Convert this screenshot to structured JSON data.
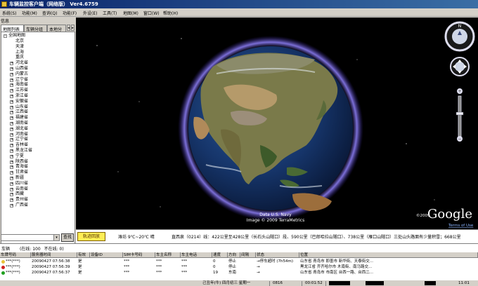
{
  "window": {
    "title": "车辆监控客户端（网络版） Ver4.6759"
  },
  "menu": [
    "系统(S)",
    "功能(M)",
    "查询(Q)",
    "功能(F)",
    "外设(E)",
    "工具(T)",
    "地图(M)",
    "窗口(W)",
    "帮助(H)"
  ],
  "left_panel": {
    "title": "信息",
    "tabs": [
      "地图列表",
      "车辆分组",
      "本地分"
    ],
    "tree_root": "全国地图",
    "cities": [
      "北京",
      "天津",
      "上海",
      "重庆"
    ],
    "provinces": [
      "河北省",
      "山西省",
      "内蒙古",
      "辽宁省",
      "海南省",
      "江苏省",
      "浙江省",
      "安徽省",
      "山东省",
      "江西省",
      "福建省",
      "湖南省",
      "湖北省",
      "河南省",
      "辽宁省",
      "吉林省",
      "黑龙江省",
      "宁夏",
      "陕西省",
      "青海省",
      "甘肃省",
      "新疆",
      "四川省",
      "云南省",
      "西藏",
      "贵州省",
      "广西省"
    ],
    "search_button": "查找"
  },
  "map": {
    "credit1": "Data U.S. Navy",
    "credit2": "Image © 2009 TerraMetrics",
    "copyright_year": "©2009",
    "logo": "Google",
    "terms": "Terms of Use",
    "nav_icons": [
      "compass-icon",
      "pan-icon",
      "zoom-slider"
    ]
  },
  "info_bar": {
    "track_button": "轨迹回放",
    "weather": "潍坊 9℃~20℃ 晴",
    "ticker": "直西泉（0214）线：422公里至428公里（长石头山隧口）段、590公里（巴郎哈拉山隧口）、738公里（雁口山隧口）三处山头路面有少量积雪；668公里"
  },
  "vehicle_list": {
    "title": "车辆",
    "online": "(在线: 100",
    "offline": "不在线: 0)",
    "columns": [
      "车牌号码",
      "服务器时间",
      "有效",
      "设备ID",
      "SIM卡号码",
      "车主名称",
      "车主电话",
      "速度",
      "方向",
      "间隔",
      "状态",
      "位置"
    ],
    "rows": [
      {
        "dot": "#e8c23a",
        "plate": "***(***)",
        "time": "20090427 07:56:38",
        "valid": "是",
        "sim": "***",
        "owner": "***",
        "phone": "***",
        "speed": "0",
        "dir": "停止",
        "state": "→停车超时 (7h54m)",
        "pos": "山东省 青岛市 即墨市 新华街、天泰街交..."
      },
      {
        "dot": "#d02020",
        "plate": "***(***)",
        "time": "20090427 07:56:39",
        "valid": "是",
        "sim": "***",
        "owner": "***",
        "phone": "***",
        "speed": "0",
        "dir": "停止",
        "state": "→",
        "pos": "黑龙江省 齐齐哈尔市 木南街、南马路交..."
      },
      {
        "dot": "#20a020",
        "plate": "***(***)",
        "time": "20090427 07:56:37",
        "valid": "是",
        "sim": "***",
        "owner": "***",
        "phone": "***",
        "speed": "19",
        "dir": "东南",
        "state": "→",
        "pos": "山东省 青岛市 市南区 台西一路、台西二..."
      }
    ]
  },
  "status_bar": {
    "date": "己丑年(牛) 四月初三 星期一",
    "code": "0816",
    "timer": "00:01:52",
    "clock": "11:01"
  },
  "colors": {
    "titlebar": "#0a246a",
    "track_button": "#ffee55",
    "atmosphere": "#6b5bd6"
  }
}
